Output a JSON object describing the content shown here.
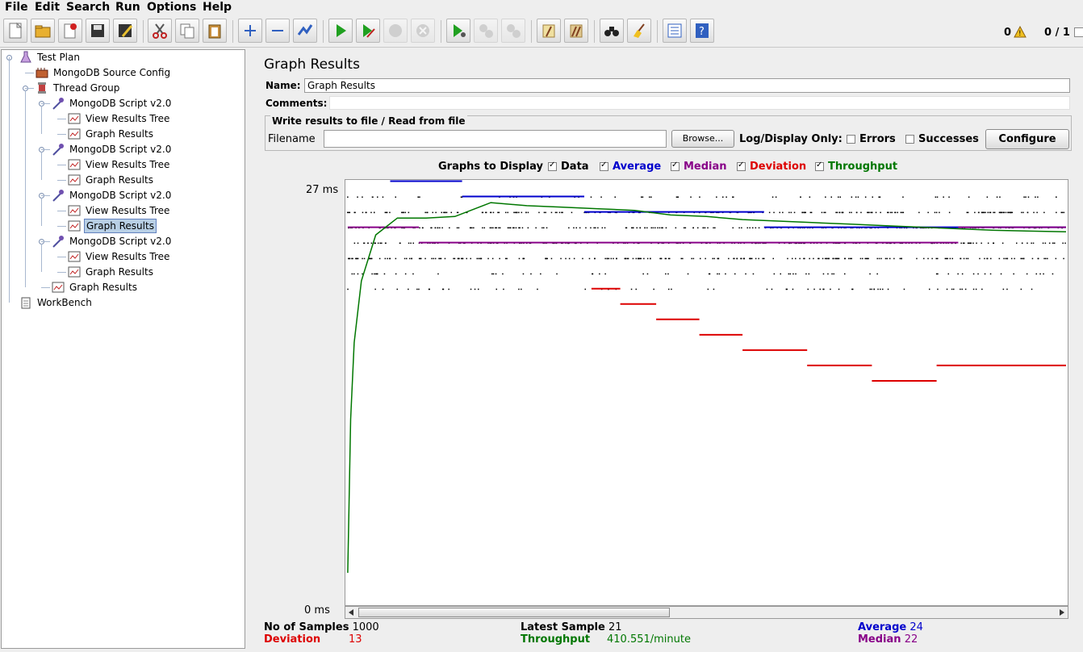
{
  "menu": [
    "File",
    "Edit",
    "Search",
    "Run",
    "Options",
    "Help"
  ],
  "status": {
    "warnings": "0",
    "threads": "0 / 1"
  },
  "toolbar": [
    "new",
    "open",
    "close",
    "save",
    "save-as",
    "cut",
    "copy",
    "paste",
    "expand",
    "collapse",
    "toggle",
    "start",
    "start-no-pause",
    "stop",
    "shutdown",
    "remote-start",
    "remote-stop",
    "remote-shutdown",
    "clear",
    "clear-all",
    "search",
    "reset-search",
    "function-helper",
    "help"
  ],
  "tree": [
    {
      "label": "Test Plan",
      "icon": "flask-icon"
    },
    {
      "label": "MongoDB Source Config",
      "icon": "config-icon"
    },
    {
      "label": "Thread Group",
      "icon": "spool-icon"
    },
    {
      "label": "MongoDB Script v2.0",
      "icon": "pipette-icon"
    },
    {
      "label": "View Results Tree",
      "icon": "listener-icon"
    },
    {
      "label": "Graph Results",
      "icon": "listener-icon"
    },
    {
      "label": "MongoDB Script v2.0",
      "icon": "pipette-icon"
    },
    {
      "label": "View Results Tree",
      "icon": "listener-icon"
    },
    {
      "label": "Graph Results",
      "icon": "listener-icon"
    },
    {
      "label": "MongoDB Script v2.0",
      "icon": "pipette-icon"
    },
    {
      "label": "View Results Tree",
      "icon": "listener-icon"
    },
    {
      "label": "Graph Results",
      "icon": "listener-icon"
    },
    {
      "label": "MongoDB Script v2.0",
      "icon": "pipette-icon"
    },
    {
      "label": "View Results Tree",
      "icon": "listener-icon"
    },
    {
      "label": "Graph Results",
      "icon": "listener-icon"
    },
    {
      "label": "Graph Results",
      "icon": "listener-icon"
    },
    {
      "label": "WorkBench",
      "icon": "clipboard-icon"
    }
  ],
  "panel": {
    "title": "Graph Results",
    "name_label": "Name:",
    "name_value": "Graph Results",
    "comments_label": "Comments:",
    "comments_value": "",
    "file_legend": "Write results to file / Read from file",
    "filename_label": "Filename",
    "filename_value": "",
    "browse_label": "Browse...",
    "log_display_label": "Log/Display Only:",
    "errors_label": "Errors",
    "successes_label": "Successes",
    "configure_label": "Configure",
    "graphs_label": "Graphs to Display",
    "graph_options": [
      {
        "label": "Data",
        "checked": true,
        "color": "#000000"
      },
      {
        "label": "Average",
        "checked": true,
        "color": "#0000cc"
      },
      {
        "label": "Median",
        "checked": true,
        "color": "#880088"
      },
      {
        "label": "Deviation",
        "checked": true,
        "color": "#dd0000"
      },
      {
        "label": "Throughput",
        "checked": true,
        "color": "#007700"
      }
    ],
    "y_max_label": "27 ms",
    "y_min_label": "0 ms"
  },
  "stats": {
    "samples_label": "No of Samples",
    "samples_value": "1000",
    "latest_label": "Latest Sample",
    "latest_value": "21",
    "average_label": "Average",
    "average_value": "24",
    "deviation_label": "Deviation",
    "deviation_value": "13",
    "throughput_label": "Throughput",
    "throughput_value": "410.551/minute",
    "median_label": "Median",
    "median_value": "22"
  },
  "chart_data": {
    "type": "line",
    "y_unit": "ms",
    "ylim": [
      0,
      27
    ],
    "samples": 1000,
    "series": [
      {
        "name": "Average",
        "color": "#0000cc",
        "points": [
          [
            60,
            27.5
          ],
          [
            160,
            26.5
          ],
          [
            330,
            25.5
          ],
          [
            580,
            24.5
          ],
          [
            1000,
            24.4
          ]
        ]
      },
      {
        "name": "Median",
        "color": "#880088",
        "points": [
          [
            1,
            24.5
          ],
          [
            100,
            23.5
          ],
          [
            850,
            24.5
          ],
          [
            1000,
            23.5
          ]
        ]
      },
      {
        "name": "Deviation",
        "color": "#dd0000",
        "points": [
          [
            340,
            20.5
          ],
          [
            380,
            19.5
          ],
          [
            430,
            18.5
          ],
          [
            490,
            17.5
          ],
          [
            550,
            16.5
          ],
          [
            640,
            15.5
          ],
          [
            730,
            14.5
          ],
          [
            820,
            15.5
          ],
          [
            1000,
            14.5
          ]
        ]
      },
      {
        "name": "Throughput",
        "color": "#007700",
        "points": [
          [
            1,
            2
          ],
          [
            5,
            12
          ],
          [
            10,
            17
          ],
          [
            20,
            21
          ],
          [
            40,
            24
          ],
          [
            70,
            25.1
          ],
          [
            110,
            25.1
          ],
          [
            150,
            25.2
          ],
          [
            200,
            26.1
          ],
          [
            250,
            25.9
          ],
          [
            300,
            25.8
          ],
          [
            350,
            25.7
          ],
          [
            400,
            25.6
          ],
          [
            450,
            25.3
          ],
          [
            500,
            25.2
          ],
          [
            550,
            25.0
          ],
          [
            600,
            24.9
          ],
          [
            650,
            24.8
          ],
          [
            700,
            24.7
          ],
          [
            750,
            24.6
          ],
          [
            800,
            24.5
          ],
          [
            850,
            24.4
          ],
          [
            900,
            24.3
          ],
          [
            1000,
            24.2
          ]
        ]
      }
    ]
  }
}
